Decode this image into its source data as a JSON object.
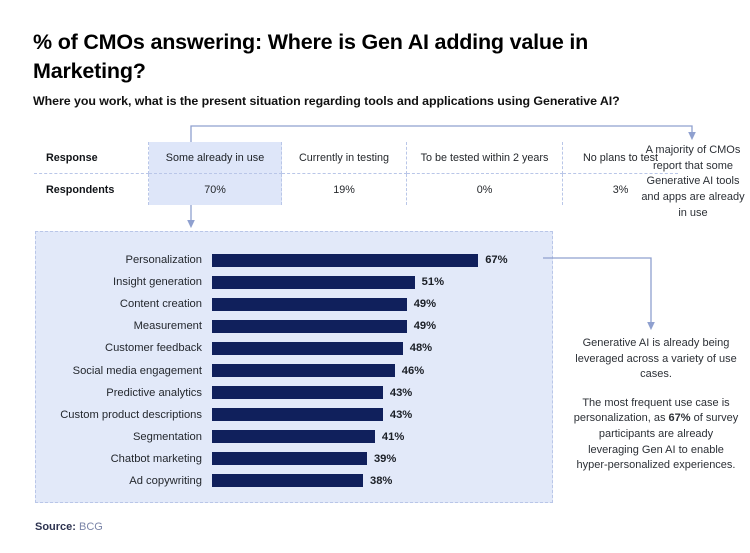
{
  "title": "% of CMOs answering: Where is Gen AI adding value in Marketing?",
  "subtitle": "Where you work, what is the present situation regarding tools and applications using Generative AI?",
  "table": {
    "row_labels": [
      "Response",
      "Respondents"
    ],
    "columns": [
      {
        "response": "Some already in use",
        "respondents": "70%",
        "highlighted": true
      },
      {
        "response": "Currently in testing",
        "respondents": "19%",
        "highlighted": false
      },
      {
        "response": "To be tested within 2 years",
        "respondents": "0%",
        "highlighted": false
      },
      {
        "response": "No plans to test",
        "respondents": "3%",
        "highlighted": false
      }
    ]
  },
  "annotations": {
    "top_right": "A majority of CMOs report that some Generative AI tools and apps are already in use",
    "side_paragraph_1": "Generative AI is already being leveraged across a variety of use cases.",
    "side_paragraph_2_before": "The most frequent use case is personalization, as ",
    "side_paragraph_2_bold": "67%",
    "side_paragraph_2_after": " of survey participants are already leveraging Gen AI to enable hyper-personalized experiences."
  },
  "source": {
    "label": "Source:",
    "value": "BCG"
  },
  "colors": {
    "bar": "#10205c",
    "panel_background": "#e2e9f9",
    "panel_border": "#b9c6e8",
    "highlight_cell": "#dee6f9",
    "connector": "#8fa0cf"
  },
  "chart_data": {
    "type": "bar",
    "title": "% of CMOs answering: Where is Gen AI adding value in Marketing?",
    "subtitle": "Where you work, what is the present situation regarding tools and applications using Generative AI?",
    "xlabel": "",
    "ylabel": "",
    "xlim": [
      0,
      75
    ],
    "grid": false,
    "legend": "none",
    "orientation": "horizontal",
    "categories": [
      "Personalization",
      "Insight generation",
      "Content creation",
      "Measurement",
      "Customer feedback",
      "Social media engagement",
      "Predictive analytics",
      "Custom product descriptions",
      "Segmentation",
      "Chatbot marketing",
      "Ad copywriting"
    ],
    "values": [
      67,
      51,
      49,
      49,
      48,
      46,
      43,
      43,
      41,
      39,
      38
    ],
    "value_labels": [
      "67%",
      "51%",
      "49%",
      "49%",
      "48%",
      "46%",
      "43%",
      "43%",
      "41%",
      "39%",
      "38%"
    ]
  }
}
